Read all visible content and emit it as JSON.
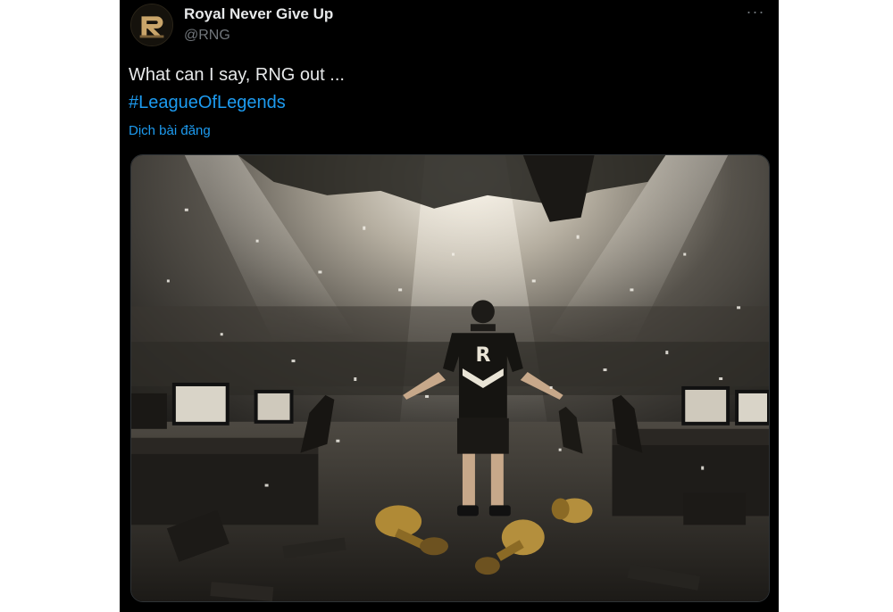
{
  "author": {
    "display_name": "Royal Never Give Up",
    "handle": "@RNG",
    "avatar_icon": "rng-logo"
  },
  "menu": {
    "more_label": "···"
  },
  "post": {
    "text": "What can I say, RNG out ...",
    "hashtag": "#LeagueOfLegends",
    "translate_label": "Dịch bài đăng"
  },
  "media": {
    "alt_description": "",
    "jersey_logo": "R"
  },
  "colors": {
    "background": "#000000",
    "text": "#e7e9ea",
    "secondary": "#71767b",
    "link": "#1d9bf0"
  }
}
